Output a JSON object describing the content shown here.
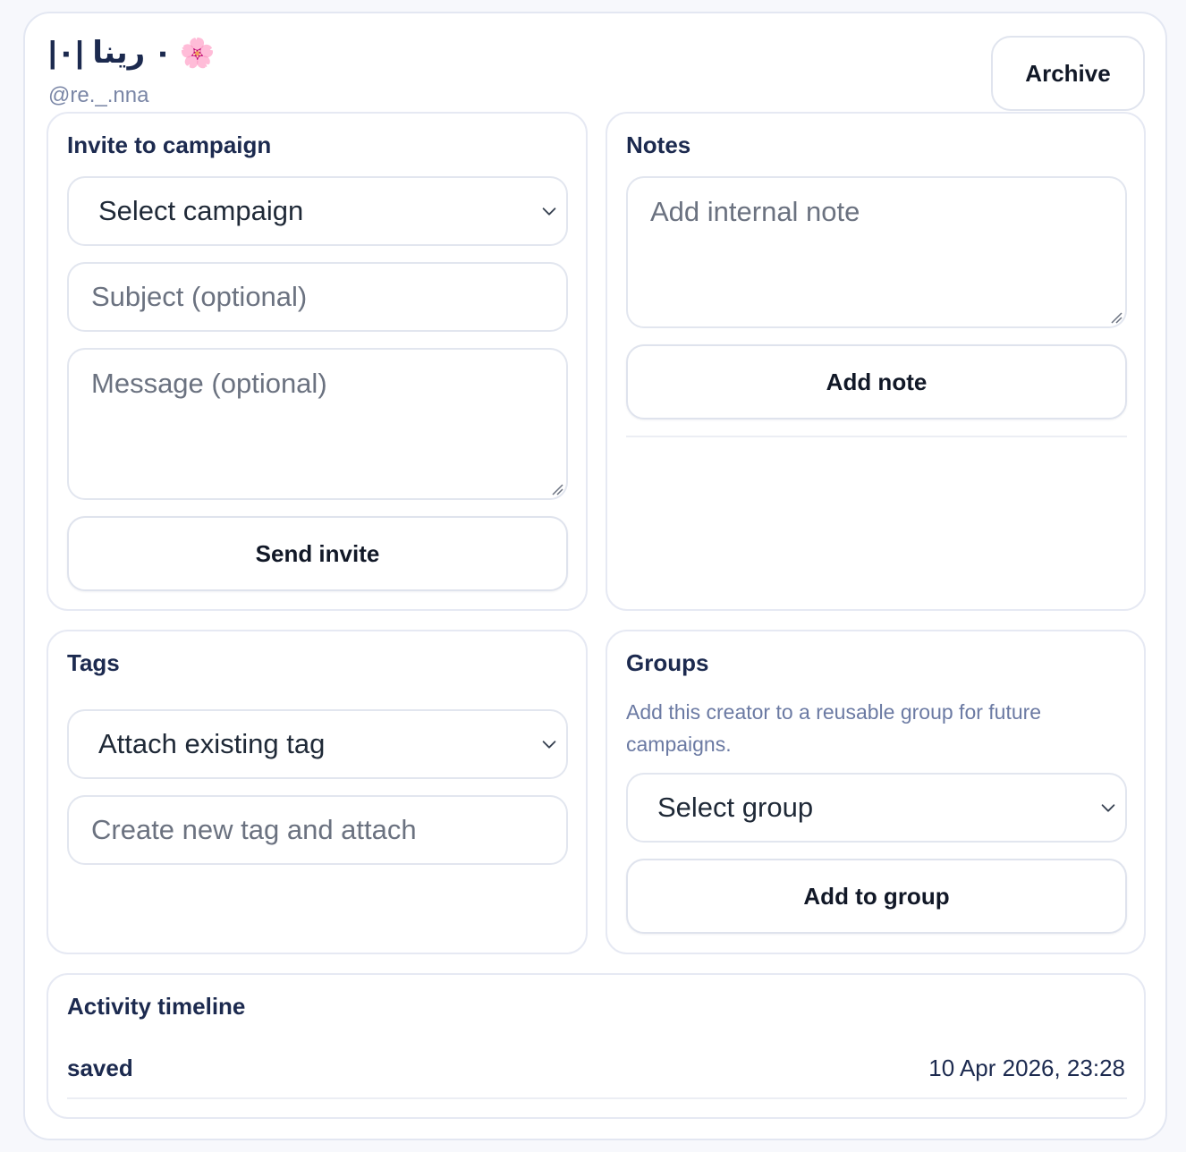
{
  "profile": {
    "display_name": "|٠ رينا |٠",
    "emoji": "🌸",
    "handle": "@re._.nna",
    "archive_label": "Archive"
  },
  "invite": {
    "title": "Invite to campaign",
    "campaign_select": "Select campaign",
    "subject_placeholder": "Subject (optional)",
    "message_placeholder": "Message (optional)",
    "send_label": "Send invite"
  },
  "notes": {
    "title": "Notes",
    "note_placeholder": "Add internal note",
    "add_label": "Add note"
  },
  "tags": {
    "title": "Tags",
    "tag_select": "Attach existing tag",
    "new_tag_placeholder": "Create new tag and attach"
  },
  "groups": {
    "title": "Groups",
    "description": "Add this creator to a reusable group for future campaigns.",
    "group_select": "Select group",
    "add_label": "Add to group"
  },
  "timeline": {
    "title": "Activity timeline",
    "events": [
      {
        "label": "saved",
        "time": "10 Apr 2026, 23:28"
      }
    ]
  }
}
